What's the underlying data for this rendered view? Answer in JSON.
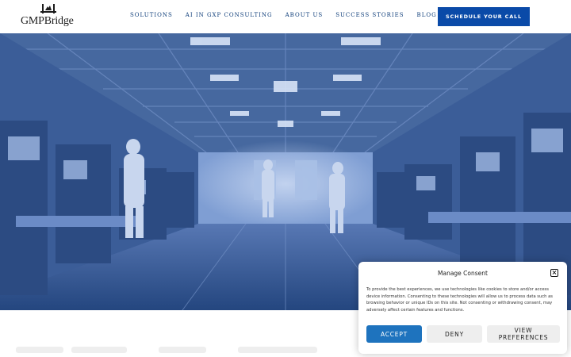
{
  "header": {
    "logo_text": "GMPBridge",
    "nav": [
      {
        "label": "SOLUTIONS"
      },
      {
        "label": "AI IN GXP CONSULTING"
      },
      {
        "label": "ABOUT US"
      },
      {
        "label": "SUCCESS STORIES"
      },
      {
        "label": "BLOG"
      }
    ],
    "language_icon": "uk-flag-icon",
    "cta_label": "SCHEDULE YOUR CALL"
  },
  "hero": {
    "image": "cleanroom laboratory with technicians in protective suits",
    "tint_color": "#3d5f9c"
  },
  "consent": {
    "title": "Manage Consent",
    "body": "To provide the best experiences, we use technologies like cookies to store and/or access device information. Consenting to these technologies will allow us to process data such as browsing behavior or unique IDs on this site. Not consenting or withdrawing consent, may adversely affect certain features and functions.",
    "accept_label": "ACCEPT",
    "deny_label": "DENY",
    "preferences_label": "VIEW PREFERENCES",
    "close_icon": "close-icon"
  },
  "colors": {
    "brand_blue": "#0a4aa8",
    "nav_text": "#0b3b78",
    "accept_blue": "#1e73be"
  }
}
